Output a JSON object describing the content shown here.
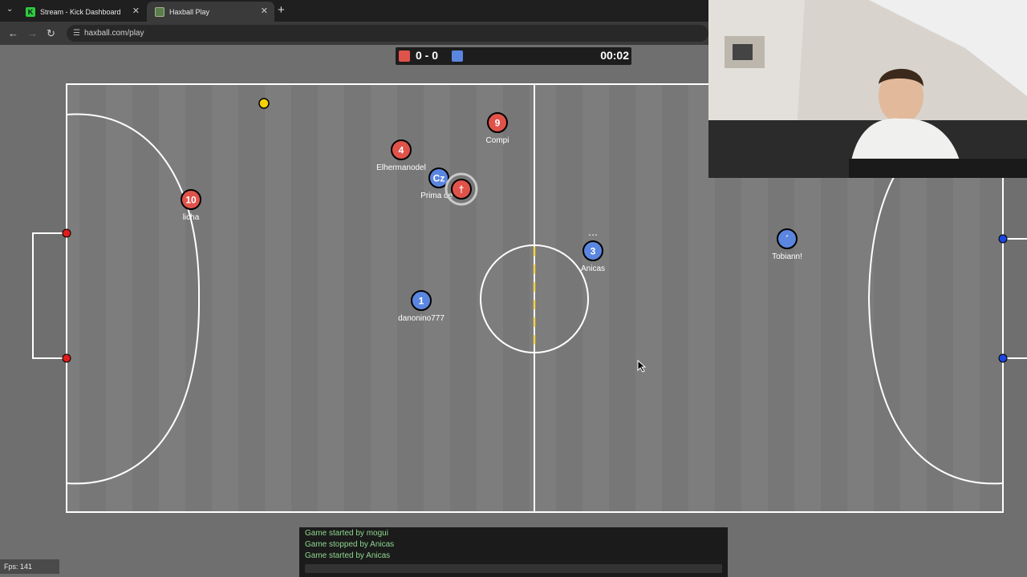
{
  "browser": {
    "tabs": [
      {
        "title": "Stream - Kick Dashboard",
        "favicon": "kick-logo-icon",
        "active": false
      },
      {
        "title": "Haxball Play",
        "favicon": "haxball-icon",
        "active": true
      }
    ],
    "url": "haxball.com/play"
  },
  "scoreboard": {
    "red_color": "#e0534a",
    "blue_color": "#5b86e0",
    "score": "0 - 0",
    "time": "00:02"
  },
  "players": [
    {
      "number": "9",
      "name": "Compi",
      "team": "red"
    },
    {
      "number": "4",
      "name": "Elhermanodel",
      "team": "red"
    },
    {
      "number": "Cz",
      "name": "Prima de t",
      "team": "blue"
    },
    {
      "number": "†",
      "name": "",
      "team": "red"
    },
    {
      "number": "10",
      "name": "licha",
      "team": "red"
    },
    {
      "number": "3",
      "name": "Anicas",
      "team": "blue",
      "typing": true
    },
    {
      "number": "´",
      "name": "Tobiann!",
      "team": "blue"
    },
    {
      "number": "1",
      "name": "danonino777",
      "team": "blue"
    }
  ],
  "chat": {
    "messages": [
      "Game started by mogui",
      "Game stopped by Anicas",
      "Game started by Anicas"
    ]
  },
  "fps": "Fps: 141",
  "colors": {
    "red_team": "#e0534a",
    "blue_team": "#5b86e0",
    "ball": "#f5d10a",
    "pitch": "#7a7a7a"
  }
}
